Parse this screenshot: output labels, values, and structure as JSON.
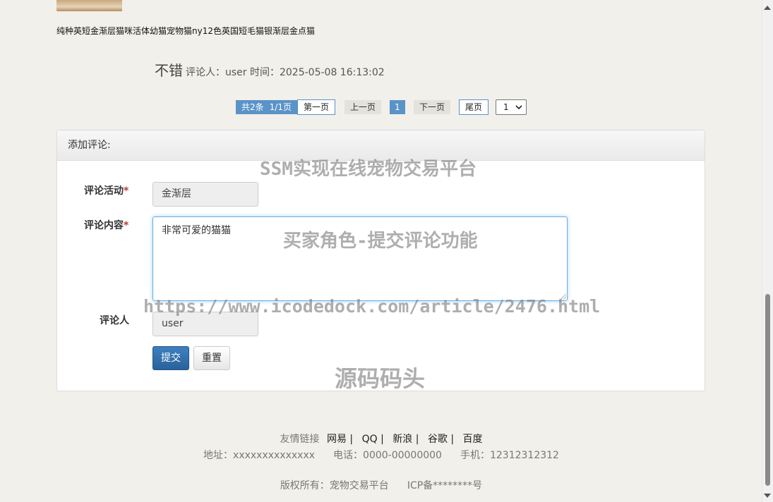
{
  "product": {
    "title": "纯种英短金渐层猫咪活体幼猫宠物猫ny12色英国短毛猫银渐层金点猫"
  },
  "comment": {
    "text": "不错",
    "meta": "评论人：user 时间：2025-05-08 16:13:02"
  },
  "pagination": {
    "total": "共2条",
    "pages": "1/1页",
    "first": "第一页",
    "prev": "上一页",
    "current": "1",
    "next": "下一页",
    "last": "尾页",
    "select_value": "1"
  },
  "form": {
    "title": "添加评论:",
    "activity_label": "评论活动",
    "activity_value": "金渐层",
    "content_label": "评论内容",
    "content_value": "非常可爱的猫猫",
    "reviewer_label": "评论人",
    "reviewer_value": "user",
    "required_mark": "*",
    "submit": "提交",
    "reset": "重置"
  },
  "watermarks": {
    "title": "SSM实现在线宠物交易平台",
    "subtitle": "买家角色-提交评论功能",
    "url": "https://www.icodedock.com/article/2476.html",
    "brand": "源码码头"
  },
  "footer": {
    "links_label": "友情链接",
    "links": [
      "网易 |",
      "QQ |",
      "新浪 |",
      "谷歌 |",
      "百度"
    ],
    "address": "地址：xxxxxxxxxxxxxx",
    "phone": "电话：0000-00000000",
    "mobile": "手机：12312312312",
    "copyright": "版权所有：宠物交易平台",
    "icp": "ICP备********号"
  },
  "colors": {
    "accent": "#5a93c8",
    "submit": "#2a629b",
    "background": "#f1f0ea"
  }
}
